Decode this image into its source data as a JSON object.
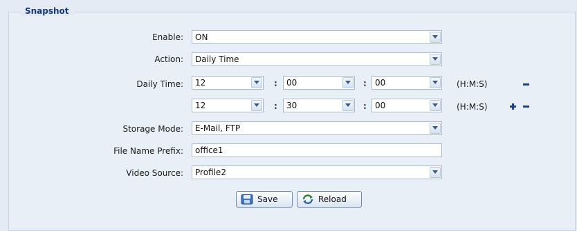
{
  "section": {
    "title": "Snapshot"
  },
  "form": {
    "enable": {
      "label": "Enable:",
      "value": "ON"
    },
    "action": {
      "label": "Action:",
      "value": "Daily Time"
    },
    "daily_time": {
      "label": "Daily Time:",
      "separator": ":",
      "rows": [
        {
          "hour": "12",
          "minute": "00",
          "second": "00",
          "unit": "(H:M:S)"
        },
        {
          "hour": "12",
          "minute": "30",
          "second": "00",
          "unit": "(H:M:S)"
        }
      ]
    },
    "storage_mode": {
      "label": "Storage Mode:",
      "value": "E-Mail, FTP"
    },
    "file_name_prefix": {
      "label": "File Name Prefix:",
      "value": "office1"
    },
    "video_source": {
      "label": "Video Source:",
      "value": "Profile2"
    }
  },
  "buttons": {
    "save_label": "Save",
    "reload_label": "Reload"
  },
  "colors": {
    "accent": "#1f3f8f",
    "title": "#16387c",
    "border": "#a7b7cd"
  }
}
